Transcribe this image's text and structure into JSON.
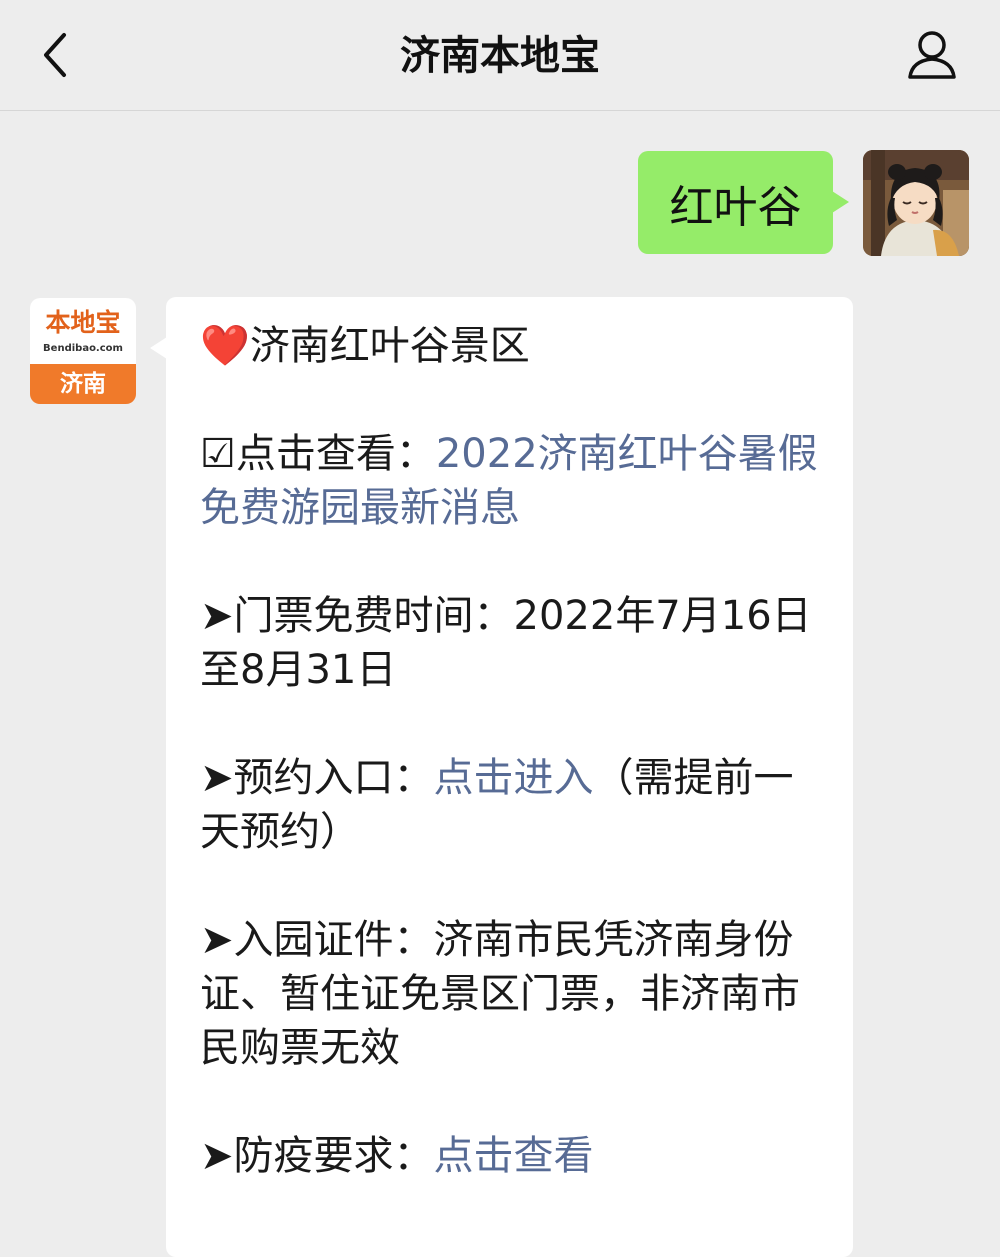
{
  "header": {
    "title": "济南本地宝",
    "back_icon": "chevron-left-icon",
    "profile_icon": "person-icon"
  },
  "outgoing": {
    "text": "红叶谷"
  },
  "bot_avatar": {
    "logo": "本地宝",
    "domain": "Bendibao.com",
    "city": "济南"
  },
  "reply": {
    "title_icon": "❤️",
    "title": "济南红叶谷景区",
    "item1": {
      "icon": "☑",
      "label": "点击查看：",
      "link": "2022济南红叶谷暑假免费游园最新消息"
    },
    "item2": {
      "icon": "➤",
      "label": "门票免费时间：",
      "value": "2022年7月16日至8月31日"
    },
    "item3": {
      "icon": "➤",
      "label": "预约入口：",
      "link": "点击进入",
      "note": "（需提前一天预约）"
    },
    "item4": {
      "icon": "➤",
      "label": "入园证件：",
      "value": "济南市民凭济南身份证、暂住证免景区门票，非济南市民购票无效"
    },
    "item5": {
      "icon": "➤",
      "label": "防疫要求：",
      "link": "点击查看"
    }
  },
  "colors": {
    "background": "#ededed",
    "outgoing_bubble": "#95ec69",
    "link": "#576b95",
    "brand_orange": "#f07a2a"
  }
}
